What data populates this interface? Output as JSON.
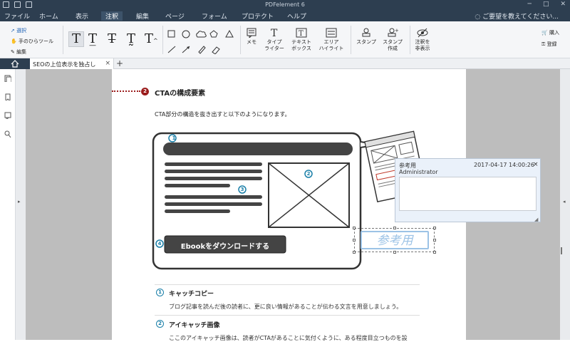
{
  "app": {
    "title": "PDFelement 6"
  },
  "menu": {
    "items": [
      "ファイル",
      "ホーム",
      "表示",
      "注釈",
      "編集",
      "ページ",
      "フォーム",
      "プロテクト",
      "ヘルプ"
    ],
    "active": "注釈",
    "help_search": "ご要望を教えてください..."
  },
  "ribbon": {
    "select": "選択",
    "hand": "手のひらツール",
    "edit": "編集",
    "memo": "メモ",
    "typewriter": [
      "タイプ",
      "ライター"
    ],
    "textbox": [
      "テキスト",
      "ボックス"
    ],
    "area_highlight": [
      "エリア",
      "ハイライト"
    ],
    "stamp": "スタンプ",
    "stamp_create": [
      "スタンプ",
      "作成"
    ],
    "hide_notes": [
      "注釈を",
      "非表示"
    ],
    "purchase": "購入",
    "register": "登録"
  },
  "tabs": {
    "doc_tab": "SEOの上位表示を独占し"
  },
  "doc": {
    "section2_number": "2",
    "section2_title": "CTAの構成要素",
    "intro": "CTA部分の構造を抜き出すと以下のようになります。",
    "cta_button": "Ebookをダウンロードする",
    "markers": [
      "1",
      "2",
      "3",
      "4"
    ],
    "items": [
      {
        "num": "1",
        "title": "キャッチコピー",
        "desc": "ブログ記事を読んだ後の読者に、更に良い情報があることが伝わる文言を用意しましょう。"
      },
      {
        "num": "2",
        "title": "アイキャッチ画像",
        "desc": "ここのアイキャッチ画像は、読者がCTAがあることに気付くように、ある程度目立つものを設"
      }
    ]
  },
  "note": {
    "title": "参考用",
    "timestamp": "2017-04-17 14:00:26",
    "author": "Administrator"
  },
  "stamp": {
    "text": "参考用"
  },
  "colors": {
    "titlebar": "#2d3e50",
    "accent": "#1a7fa8",
    "dark_red": "#9b1c1c",
    "stamp": "#9cc3e6"
  }
}
